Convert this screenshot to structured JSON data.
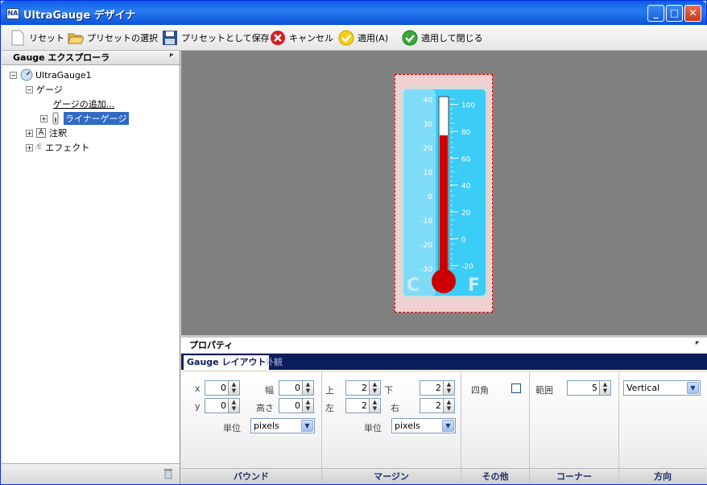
{
  "window": {
    "title": "UltraGauge デザイナ",
    "app_icon": "NA",
    "min": "_",
    "max": "□",
    "close": "✕"
  },
  "toolbar": {
    "items": [
      {
        "label": "リセット",
        "icon": "page-icon"
      },
      {
        "label": "プリセットの選択",
        "icon": "folder-open-icon"
      },
      {
        "label": "プリセットとして保存",
        "icon": "floppy-disk-icon"
      },
      {
        "label": "キャンセル",
        "icon": "red-x-icon"
      },
      {
        "label": "適用(A)",
        "icon": "yellow-check-icon"
      },
      {
        "label": "適用して閉じる",
        "icon": "green-check-icon"
      }
    ]
  },
  "explorer": {
    "title": "Gauge エクスプローラ",
    "pin": "ᴾ",
    "root": "UltraGauge1",
    "gauges": "ゲージ",
    "add_gauge": "ゲージの追加...",
    "linear_gauge": "ライナーゲージ",
    "annotation": "注釈",
    "effects": "エフェクト",
    "delete_icon": "trash-icon"
  },
  "gauge": {
    "celsius_ticks": [
      "40",
      "30",
      "20",
      "10",
      "0",
      "-10",
      "-20",
      "-30"
    ],
    "fahrenheit_ticks": [
      "100",
      "80",
      "60",
      "40",
      "20",
      "0",
      "-20"
    ],
    "c_label": "C",
    "f_label": "F",
    "value_c": 25,
    "min_c": -30,
    "max_c": 40,
    "colors": {
      "bezel": "#d8d8d8",
      "face": "#3ccdf6",
      "mercury": "#cc0000",
      "tube": "#ffffff"
    }
  },
  "properties": {
    "title": "プロパティ",
    "pin": "ᴾ",
    "tabs": [
      "Gauge レイアウト",
      "外観"
    ],
    "bounds": {
      "label": "バウンド",
      "x_label": "x",
      "x": "0",
      "y_label": "y",
      "y": "0",
      "width_label": "幅",
      "width": "0",
      "height_label": "高さ",
      "height": "0",
      "unit_label": "単位",
      "unit": "pixels"
    },
    "margins": {
      "label": "マージン",
      "top_label": "上",
      "top": "2",
      "bottom_label": "下",
      "bottom": "2",
      "left_label": "左",
      "left": "2",
      "right_label": "右",
      "right": "2",
      "unit_label": "単位",
      "unit": "pixels"
    },
    "other": {
      "label": "その他",
      "square_label": "四角",
      "square_checked": false
    },
    "corner": {
      "label": "コーナー",
      "range_label": "範囲",
      "range": "5"
    },
    "direction": {
      "label": "方向",
      "value": "Vertical"
    }
  }
}
